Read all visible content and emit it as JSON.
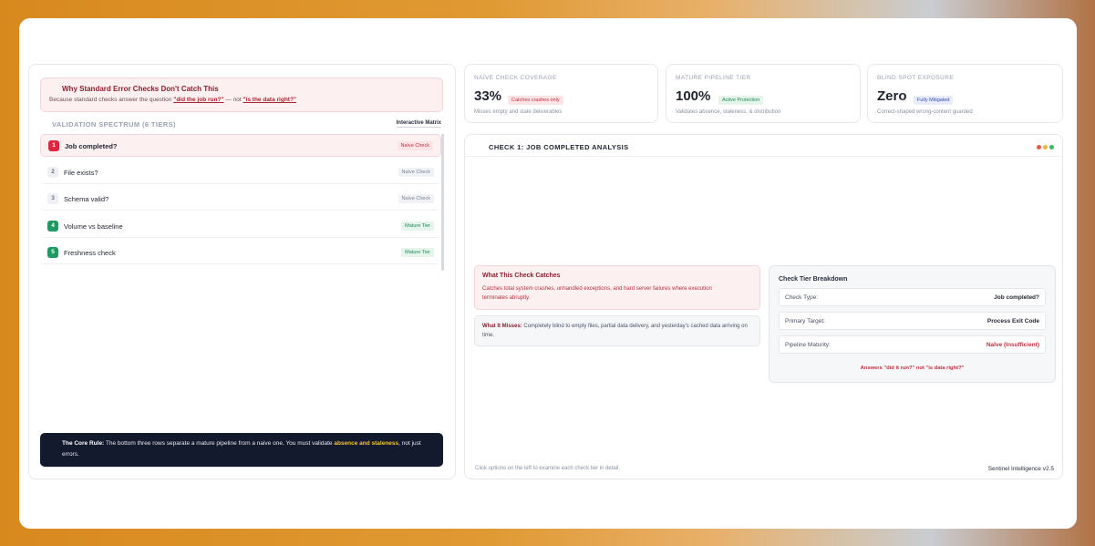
{
  "left": {
    "warning": {
      "title": "Why Standard Error Checks Don't Catch This",
      "text_prefix": "Because standard checks answer the question ",
      "question_a": "\"did the job run?\"",
      "text_mid": " — not ",
      "question_b": "\"is the data right?\""
    },
    "spectrum_title": "VALIDATION SPECTRUM (6 TIERS)",
    "matrix_badge": "Interactive Matrix",
    "tiers": [
      {
        "num": "1",
        "label": "Job completed?",
        "badge": "Naïve Check"
      },
      {
        "num": "2",
        "label": "File exists?",
        "badge": "Naïve Check"
      },
      {
        "num": "3",
        "label": "Schema valid?",
        "badge": "Naïve Check"
      },
      {
        "num": "4",
        "label": "Volume vs baseline",
        "badge": "Mature Tier"
      },
      {
        "num": "5",
        "label": "Freshness check",
        "badge": "Mature Tier"
      }
    ],
    "core_rule": {
      "label": "The Core Rule:",
      "text_a": " The bottom three rows separate a mature pipeline from a naive one. You must validate ",
      "highlight": "absence and staleness",
      "text_b": ", not just errors."
    }
  },
  "stats": [
    {
      "label": "NAÏVE CHECK COVERAGE",
      "value": "33%",
      "pill": "Catches crashes only",
      "sub": "Misses empty and stale deliverables"
    },
    {
      "label": "MATURE PIPELINE TIER",
      "value": "100%",
      "pill": "Active Protection",
      "sub": "Validates absence, staleness, & distribution"
    },
    {
      "label": "BLIND SPOT EXPOSURE",
      "value": "Zero",
      "pill": "Fully Mitigated",
      "sub": "Correct-shaped wrong-content guarded"
    }
  ],
  "analysis": {
    "title": "CHECK 1: JOB COMPLETED ANALYSIS",
    "catches_title": "What This Check Catches",
    "catches_text": "Catches total system crashes, unhandled exceptions, and hard server failures where execution terminates abruptly.",
    "misses_label": "What It Misses:",
    "misses_text": " Completely blind to empty files, partial data delivery, and yesterday's cached data arriving on time.",
    "breakdown": {
      "title": "Check Tier Breakdown",
      "rows": [
        {
          "key": "Check Type:",
          "value": "Job completed?"
        },
        {
          "key": "Primary Target:",
          "value": "Process Exit Code"
        },
        {
          "key": "Pipeline Maturity:",
          "value": "Naïve (Insufficient)"
        }
      ],
      "note": "Answers \"did it run?\" not \"is data right?\""
    },
    "footer_hint": "Click options on the left to examine each check tier in detail.",
    "footer_version": "Sentinel Intelligence v2.5"
  },
  "colors": {
    "accent_red": "#e0263e",
    "accent_green": "#1f9a62",
    "navy": "#141a2e"
  }
}
